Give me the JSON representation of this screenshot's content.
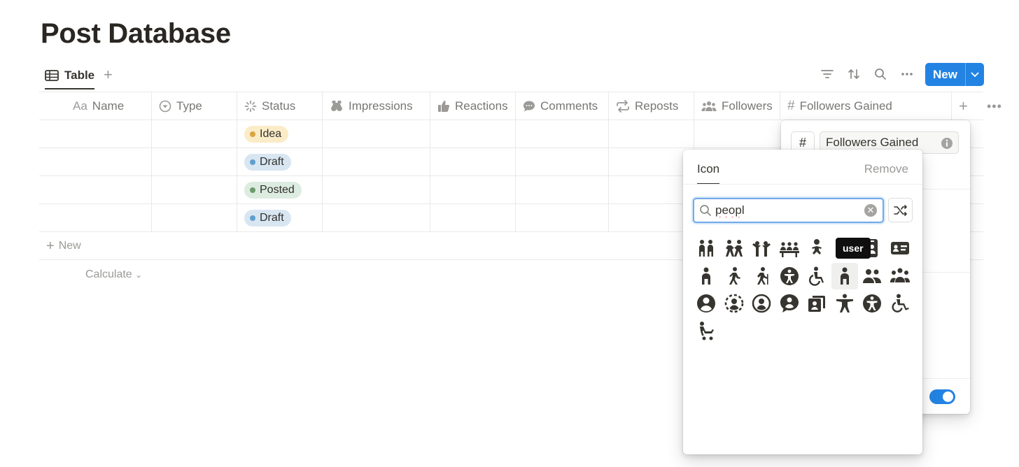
{
  "page": {
    "title": "Post Database"
  },
  "view": {
    "tab_label": "Table",
    "add_view": "+",
    "new_label": "New"
  },
  "columns": [
    {
      "label": "Name",
      "icon": "aa-text-icon"
    },
    {
      "label": "Type",
      "icon": "select-icon"
    },
    {
      "label": "Status",
      "icon": "status-icon"
    },
    {
      "label": "Impressions",
      "icon": "binoculars-icon"
    },
    {
      "label": "Reactions",
      "icon": "thumbs-up-icon"
    },
    {
      "label": "Comments",
      "icon": "comment-icon"
    },
    {
      "label": "Reposts",
      "icon": "repost-icon"
    },
    {
      "label": "Followers",
      "icon": "people-icon"
    },
    {
      "label": "Followers Gained",
      "icon": "hash-icon"
    }
  ],
  "name_prefix": "Aa",
  "rows": [
    {
      "status": "Idea",
      "status_color": "#d9a33f",
      "status_bg": "#fbecc8"
    },
    {
      "status": "Draft",
      "status_color": "#5f9fd0",
      "status_bg": "#d8e6f2"
    },
    {
      "status": "Posted",
      "status_color": "#6c9b6e",
      "status_bg": "#dcece0"
    },
    {
      "status": "Draft",
      "status_color": "#5f9fd0",
      "status_bg": "#d8e6f2"
    }
  ],
  "footer": {
    "new_row": "New",
    "calculate": "Calculate"
  },
  "property_panel": {
    "hash": "#",
    "name": "Followers Gained",
    "toggle_on": true
  },
  "icon_picker": {
    "tab": "Icon",
    "remove": "Remove",
    "search_value": "peopl",
    "tooltip": "user",
    "icons": [
      "people-pair-icon",
      "people-holding-hands-icon",
      "people-arms-up-icon",
      "people-group-table-icon",
      "baby-icon",
      "person-stretch-icon",
      "user-badge-icon",
      "id-card-icon",
      "person-standing-icon",
      "person-walking-icon",
      "person-hiking-icon",
      "accessibility-circle-icon",
      "wheelchair-icon",
      "user-icon",
      "people-two-icon",
      "people-three-icon",
      "user-circle-icon",
      "user-circle-dashed-icon",
      "user-circle-outline-icon",
      "user-chat-icon",
      "user-square-icon",
      "person-arms-out-icon",
      "accessibility-icon",
      "wheelchair-motion-icon",
      "stroller-icon"
    ],
    "selected_icon": "user-icon"
  },
  "colors": {
    "accent": "#2383e2",
    "text": "#37352f",
    "muted": "#787774",
    "border": "#e9e9e7"
  }
}
